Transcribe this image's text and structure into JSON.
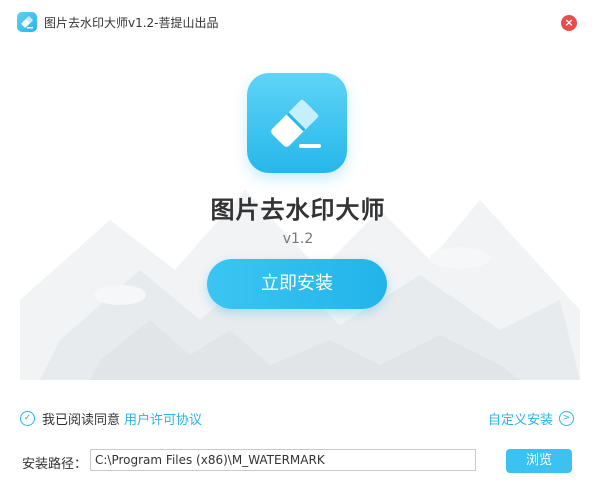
{
  "window": {
    "title": "图片去水印大师v1.2-菩提山出品",
    "close_symbol": "×"
  },
  "hero": {
    "app_name": "图片去水印大师",
    "version": "v1.2",
    "icon": "eraser-icon"
  },
  "install": {
    "button_label": "立即安装"
  },
  "agreement": {
    "text": "我已阅读同意",
    "link": "用户许可协议",
    "checked": true
  },
  "custom_install": {
    "label": "自定义安装"
  },
  "path": {
    "label": "安装路径：",
    "value": "C:\\Program Files (x86)\\M_WATERMARK"
  },
  "browse": {
    "label": "浏览"
  },
  "colors": {
    "accent": "#27b5ea",
    "close": "#e84c4c",
    "title_text": "#333333"
  }
}
